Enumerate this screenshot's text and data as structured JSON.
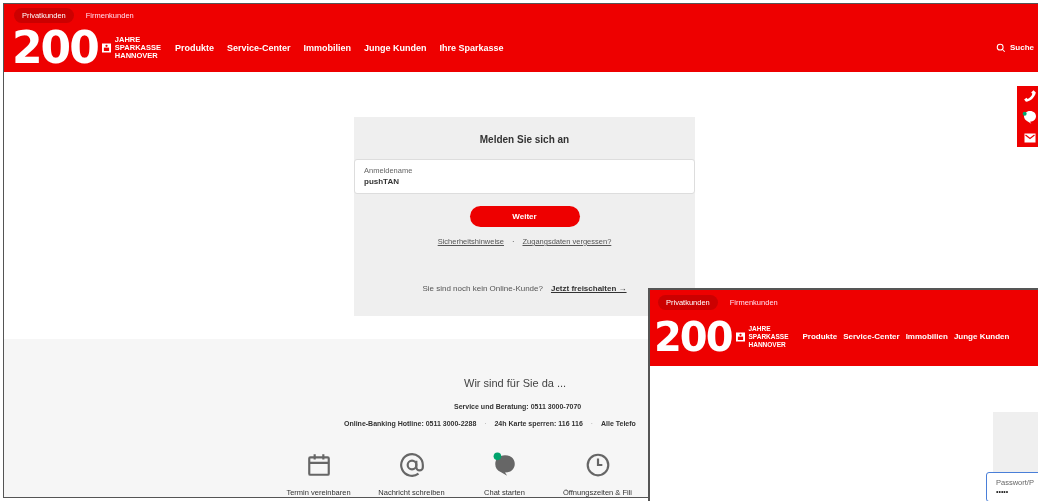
{
  "windows": [
    {
      "segments": [
        {
          "label": "Privatkunden",
          "selected": true
        },
        {
          "label": "Firmenkunden",
          "selected": false
        }
      ],
      "logo": {
        "number": "200",
        "lines": [
          "JAHRE",
          "SPARKASSE",
          "HANNOVER"
        ]
      },
      "nav": [
        "Produkte",
        "Service-Center",
        "Immobilien",
        "Junge Kunden",
        "Ihre Sparkasse"
      ],
      "search": "Suche",
      "login": {
        "title": "Melden Sie sich an",
        "field": {
          "label": "Anmeldename",
          "value": "pushTAN"
        },
        "button": "Weiter",
        "links": [
          "Sicherheitshinweise",
          "Zugangsdaten vergessen?"
        ],
        "separator": "·",
        "prompt": "Sie sind noch kein Online-Kunde?",
        "signup": "Jetzt freischalten →"
      },
      "footer": {
        "heading": "Wir sind für Sie da ...",
        "service": "Service und Beratung: 0511 3000-7070",
        "hotlines": [
          "Online-Banking Hotline: 0511 3000-2288",
          "24h Karte sperren: 116 116",
          "Alle Telefo"
        ],
        "hotline_separator": "·",
        "actions": [
          {
            "kind": "calendar",
            "label": "Termin vereinbaren"
          },
          {
            "kind": "at",
            "label": "Nachricht schreiben"
          },
          {
            "kind": "chat",
            "label": "Chat starten"
          },
          {
            "kind": "clock",
            "label": "Öffnungszeiten & Fili"
          }
        ]
      }
    },
    {
      "segments": [
        {
          "label": "Privatkunden",
          "selected": true
        },
        {
          "label": "Firmenkunden",
          "selected": false
        }
      ],
      "logo": {
        "number": "200",
        "lines": [
          "JAHRE",
          "SPARKASSE",
          "HANNOVER"
        ]
      },
      "nav": [
        "Produkte",
        "Service-Center",
        "Immobilien",
        "Junge Kunden"
      ],
      "password_field": {
        "label": "Passwort/P",
        "value": "•••••"
      }
    }
  ]
}
